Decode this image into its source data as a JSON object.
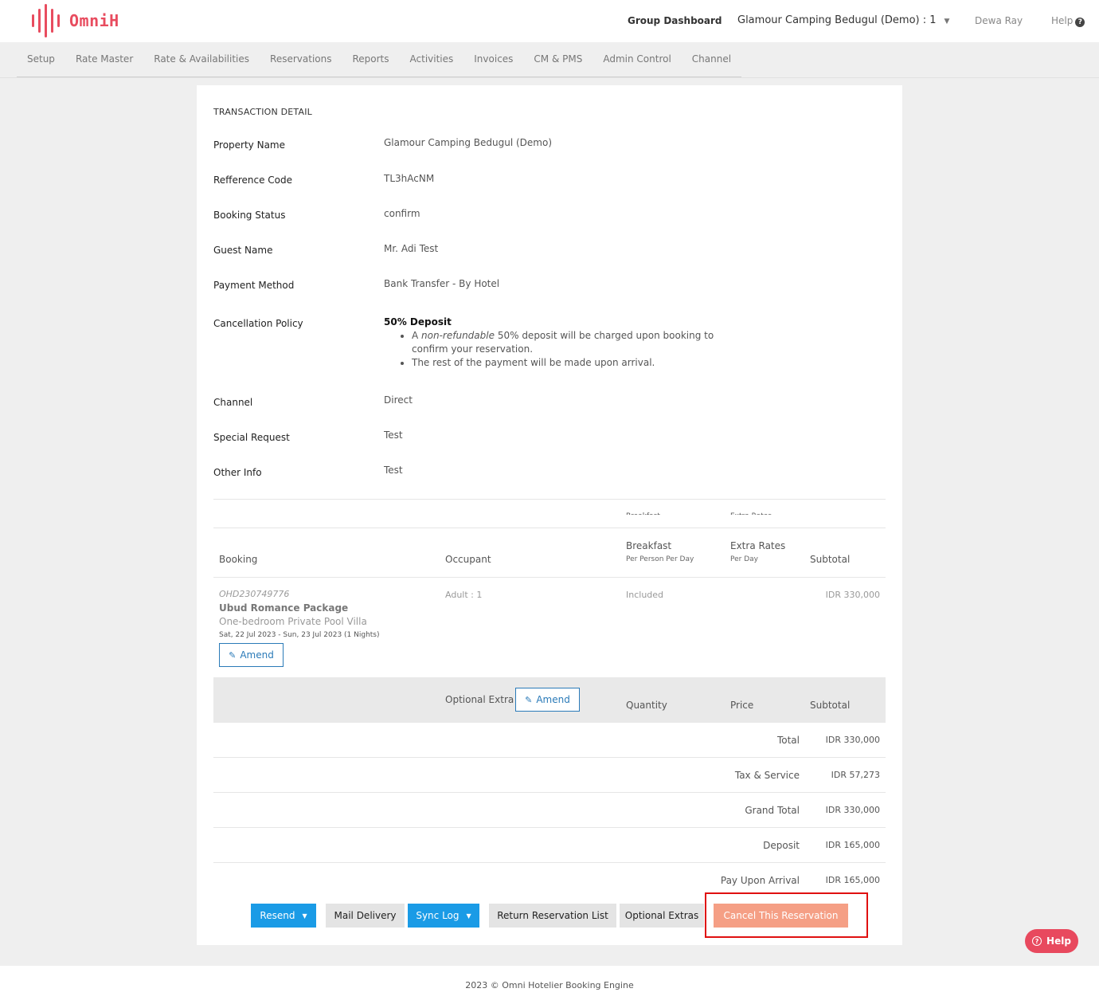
{
  "header": {
    "brand": "OmniH",
    "group_dashboard": "Group Dashboard",
    "property_selector": "Glamour Camping Bedugul (Demo) : 1",
    "user": "Dewa Ray",
    "help": "Help"
  },
  "nav": {
    "items": [
      "Setup",
      "Rate Master",
      "Rate & Availabilities",
      "Reservations",
      "Reports",
      "Activities",
      "Invoices",
      "CM & PMS",
      "Admin Control",
      "Channel"
    ]
  },
  "detail": {
    "section_title": "TRANSACTION DETAIL",
    "property_name_label": "Property Name",
    "property_name": "Glamour Camping Bedugul (Demo)",
    "reference_code_label": "Refference Code",
    "reference_code": "TL3hAcNM",
    "booking_status_label": "Booking Status",
    "booking_status": "confirm",
    "guest_name_label": "Guest Name",
    "guest_name": "Mr. Adi Test",
    "payment_method_label": "Payment Method",
    "payment_method": "Bank Transfer - By Hotel",
    "cancellation_policy_label": "Cancellation Policy",
    "policy_title": "50% Deposit",
    "policy_item1_prefix": "A",
    "policy_item1_em": "non-refundable",
    "policy_item1_rest": "50% deposit will be charged upon booking to confirm your reservation.",
    "policy_item2": "The rest of the payment will be made upon arrival.",
    "channel_label": "Channel",
    "channel": "Direct",
    "special_request_label": "Special Request",
    "special_request": "Test",
    "other_info_label": "Other Info",
    "other_info": "Test"
  },
  "booking_table": {
    "ghost_breakfast": "Breakfast",
    "ghost_extra": "Extra Rates",
    "col_booking": "Booking",
    "col_occupant": "Occupant",
    "col_breakfast": "Breakfast",
    "col_breakfast_sub": "Per Person Per Day",
    "col_extra": "Extra Rates",
    "col_extra_sub": "Per Day",
    "col_subtotal": "Subtotal",
    "row": {
      "id": "OHD230749776",
      "package": "Ubud Romance Package",
      "room": "One-bedroom Private Pool Villa",
      "dates": "Sat, 22 Jul 2023 - Sun, 23 Jul 2023 (1 Nights)",
      "amend": "Amend",
      "occupant": "Adult : 1",
      "breakfast": "Included",
      "subtotal": "IDR 330,000"
    }
  },
  "optional_extra": {
    "label": "Optional Extra",
    "amend": "Amend",
    "col_quantity": "Quantity",
    "col_price": "Price",
    "col_subtotal": "Subtotal"
  },
  "summary": {
    "total_label": "Total",
    "total": "IDR 330,000",
    "tax_label": "Tax & Service",
    "tax": "IDR 57,273",
    "grand_total_label": "Grand Total",
    "grand_total": "IDR 330,000",
    "deposit_label": "Deposit",
    "deposit": "IDR 165,000",
    "pay_upon_arrival_label": "Pay Upon Arrival",
    "pay_upon_arrival": "IDR 165,000"
  },
  "actions": {
    "resend": "Resend",
    "mail_delivery": "Mail Delivery",
    "sync_log": "Sync Log",
    "return_list": "Return Reservation List",
    "optional_extras": "Optional Extras",
    "cancel": "Cancel This Reservation"
  },
  "help_button": "Help",
  "footer": "2023 © Omni Hotelier Booking Engine",
  "colors": {
    "brand": "#e84c5f",
    "primary_blue": "#1a9be6",
    "cancel_orange": "#f59f85",
    "highlight_red": "#e01010"
  }
}
